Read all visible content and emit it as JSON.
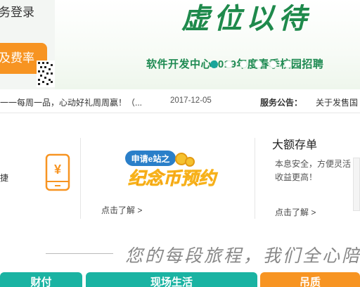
{
  "banner": {
    "login_label": "务登录",
    "fee_button": "及费率",
    "slogan": "虚位以待",
    "campus_text": "软件开发中心2019年度春季校园招聘",
    "carousel": {
      "count": 6,
      "active_index": 0
    }
  },
  "notice": {
    "headline": "一一每周一品，心动好礼周周赢！（...",
    "date": "2017-12-05",
    "service_label": "服务公告：",
    "service_link": "关于发售国"
  },
  "products": {
    "card1_text": "捷",
    "card2_more": "点击了解 >",
    "promo": {
      "line1": "申请e站之",
      "line2": "纪念币预约"
    },
    "deposit": {
      "title": "大额存单",
      "desc": "本息安全，方便灵活 收益更高！",
      "more": "点击了解 >"
    }
  },
  "tagline": "您的每段旅程，我们全心陪",
  "tabs": [
    "财付",
    "现场生活",
    "吊质"
  ],
  "colors": {
    "brand_green": "#1f8a4c",
    "teal": "#1ab3a2",
    "orange": "#f79422"
  }
}
